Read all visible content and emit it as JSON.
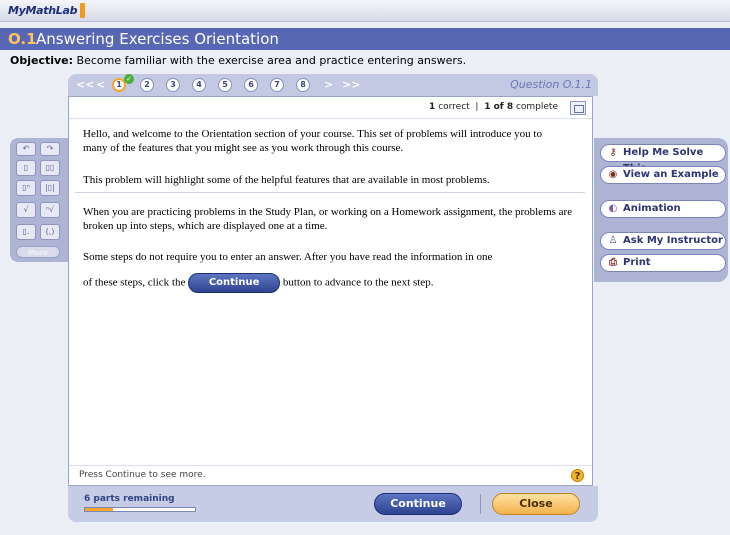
{
  "app": {
    "logo": "MyMathLab"
  },
  "header": {
    "section": "O.1",
    "title": "Answering Exercises Orientation"
  },
  "objective": {
    "label": "Objective:",
    "text": "Become familiar with the exercise area and practice entering answers."
  },
  "nav": {
    "first": "<<",
    "prev": "<",
    "next": ">",
    "last": ">>",
    "questions": [
      "1",
      "2",
      "3",
      "4",
      "5",
      "6",
      "7",
      "8"
    ],
    "current": "1",
    "question_label": "Question O.1.1"
  },
  "status": {
    "correct_count": "1",
    "correct_label": "correct",
    "complete_count": "1 of 8",
    "complete_label": "complete"
  },
  "content": {
    "p1": "Hello, and welcome to the Orientation section of your course.  This set of problems will introduce you to many of the features that you might see as you work through this course.",
    "p2": "This problem will highlight some of the helpful features that are available in most problems.",
    "p3": "When you are practicing problems in the Study Plan, or working on a Homework assignment, the problems are broken up into steps, which are displayed one at a time.",
    "p4": "Some steps do not require you to enter an answer.  After you have read the information in one",
    "p5_before": "of these steps, click the",
    "p5_button": "Continue",
    "p5_after": "button to advance to the next step."
  },
  "footer": {
    "hint": "Press Continue to see more.",
    "help_icon": "?"
  },
  "bottom": {
    "remaining": "6 parts remaining",
    "progress": 0.25,
    "continue": "Continue",
    "close": "Close"
  },
  "left_tools": {
    "more": "More"
  },
  "right_tools": {
    "help_me_solve": "Help Me Solve This",
    "view_example": "View an Example",
    "animation": "Animation",
    "ask_instructor": "Ask My Instructor",
    "print": "Print"
  }
}
